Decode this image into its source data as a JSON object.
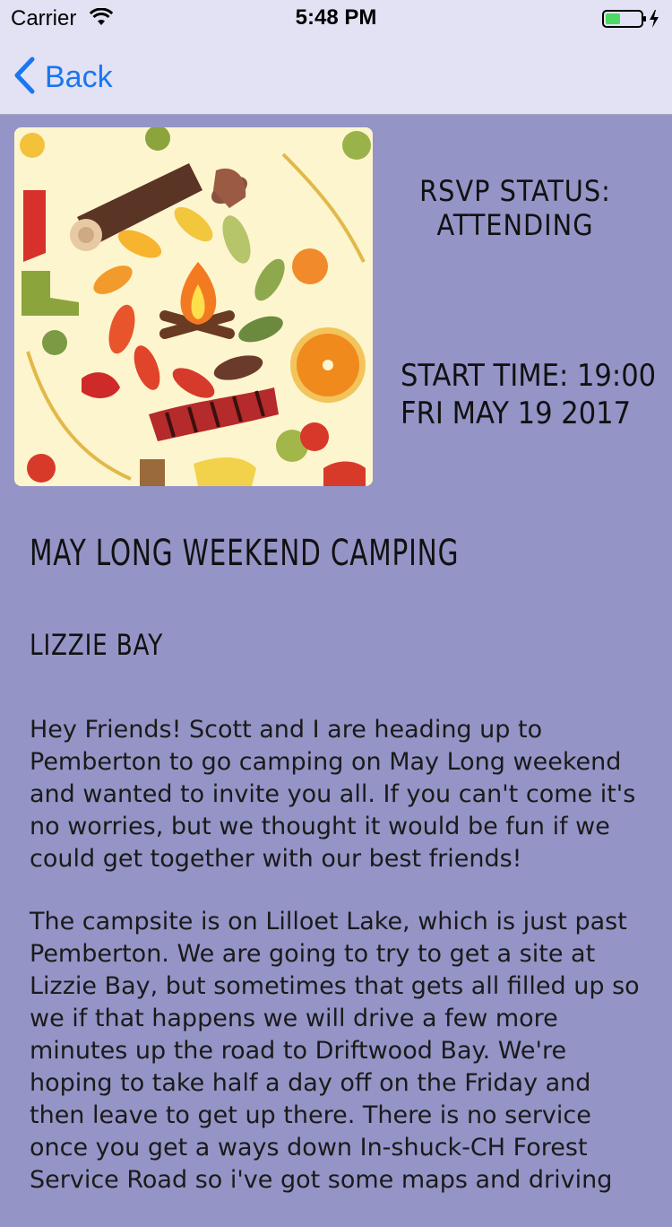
{
  "status_bar": {
    "carrier": "Carrier",
    "time": "5:48 PM"
  },
  "nav": {
    "back_label": "Back"
  },
  "event": {
    "rsvp_line1": "RSVP STATUS:",
    "rsvp_line2": "ATTENDING",
    "start_line1": "START TIME: 19:00",
    "start_line2": "FRI MAY 19 2017",
    "title": "MAY LONG WEEKEND CAMPING",
    "location": "LIZZIE BAY",
    "description": [
      "Hey Friends! Scott and I are heading up to Pemberton to go camping on May Long weekend and wanted to invite you all. If you can't come it's no worries, but we thought it would be fun if we could get together with our best friends!",
      "The campsite is on Lilloet Lake, which is just past Pemberton. We are going to try to get a site at Lizzie Bay, but sometimes that gets all filled up so we if that happens we will drive a few more minutes up the road to Driftwood Bay. We're hoping to take half a day off on the Friday and then leave to get up there. There is no service once you get a ways down In-shuck-CH Forest Service Road so i've got some maps and driving"
    ]
  },
  "colors": {
    "background": "#9594c7",
    "bar": "#e2e2f4",
    "accent": "#1a76f2",
    "battery": "#4cd964"
  },
  "icons": {
    "wifi": "wifi-icon",
    "battery": "battery-icon",
    "back": "chevron-left-icon",
    "event_image": "autumn-campfire-illustration"
  }
}
